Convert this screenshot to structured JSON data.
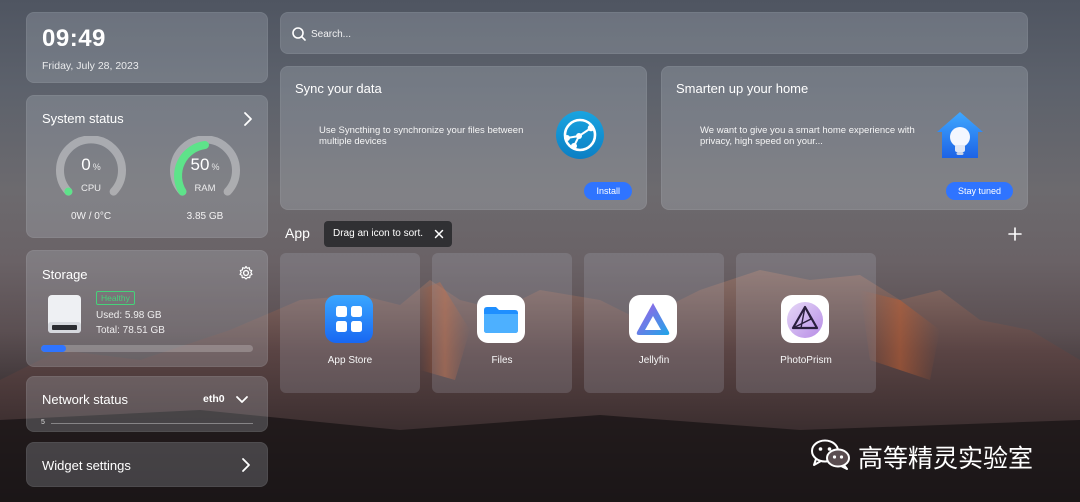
{
  "clock": {
    "time": "09:49",
    "date": "Friday, July 28, 2023"
  },
  "system_status": {
    "title": "System status",
    "cpu": {
      "value": "0",
      "unit": "%",
      "label": "CPU",
      "detail": "0W / 0°C",
      "percent": 0
    },
    "ram": {
      "value": "50",
      "unit": "%",
      "label": "RAM",
      "detail": "3.85 GB",
      "percent": 50
    }
  },
  "storage": {
    "title": "Storage",
    "health": "Healthy",
    "used": "Used: 5.98 GB",
    "total": "Total: 78.51 GB",
    "used_fraction": 0.12
  },
  "network": {
    "title": "Network status",
    "interface": "eth0",
    "axis_label": "5"
  },
  "widget_settings": {
    "label": "Widget settings"
  },
  "search": {
    "placeholder": "Search..."
  },
  "cards": [
    {
      "title": "Sync your data",
      "description": "Use Syncthing to synchronize your files between multiple devices",
      "button": "Install"
    },
    {
      "title": "Smarten up your home",
      "description": "We want to give you a smart home experience with privacy, high speed on your...",
      "button": "Stay tuned"
    }
  ],
  "apps_section": {
    "title": "App",
    "tooltip": "Drag an icon to sort."
  },
  "apps": [
    {
      "name": "App Store",
      "icon": "app-store-icon"
    },
    {
      "name": "Files",
      "icon": "files-folder-icon"
    },
    {
      "name": "Jellyfin",
      "icon": "jellyfin-icon"
    },
    {
      "name": "PhotoPrism",
      "icon": "photoprism-icon"
    }
  ],
  "watermark": {
    "text": "高等精灵实验室",
    "icon": "wechat-icon"
  },
  "colors": {
    "accent": "#2f74ff",
    "healthy": "#46d27a",
    "ram_gauge": "#5ee38a",
    "cpu_gauge": "#5ee38a"
  }
}
